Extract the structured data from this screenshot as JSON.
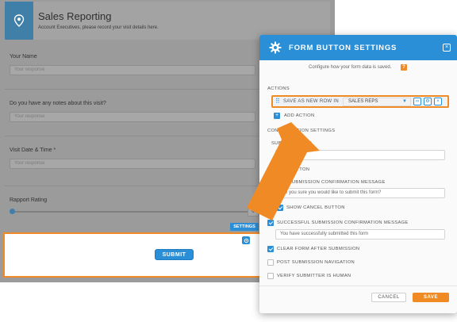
{
  "form": {
    "title": "Sales Reporting",
    "subtitle": "Account Executives, please record your visit details here.",
    "fields": [
      {
        "label": "Your Name",
        "placeholder": "Your response"
      },
      {
        "label": "Do you have any notes about this visit?",
        "placeholder": "Your response"
      },
      {
        "label": "Visit Date & Time *",
        "placeholder": "Your response"
      },
      {
        "label": "Rapport Rating",
        "slider_value": "0"
      }
    ],
    "settings_tab": "SETTINGS",
    "submit_label": "SUBMIT"
  },
  "modal": {
    "title": "FORM BUTTON SETTINGS",
    "subtitle": "Configure how your form data is saved.",
    "help": "?",
    "close": "×",
    "actions_label": "ACTIONS",
    "action_row": {
      "text": "SAVE AS NEW ROW IN",
      "selected": "SALES REPS",
      "caret": "▼"
    },
    "add_action": "ADD ACTION",
    "config_label": "CONFIGURATION SETTINGS",
    "submit_button_label": "SUBMIT BUTTON",
    "submit_button_value": "Submit",
    "clear_button_label": "CLEAR BUTTON",
    "pre_confirm_label": "PRE SUBMISSION CONFIRMATION MESSAGE",
    "pre_confirm_value": "Are you sure you would like to submit this form?",
    "show_cancel_label": "SHOW CANCEL BUTTON",
    "success_label": "SUCCESSFUL SUBMISSION CONFIRMATION MESSAGE",
    "success_value": "You have successfully submitted this form",
    "clear_after_label": "CLEAR FORM AFTER SUBMISSION",
    "post_nav_label": "POST SUBMISSION NAVIGATION",
    "verify_label": "VERIFY SUBMITTER IS HUMAN",
    "cancel_label": "CANCEL",
    "save_label": "SAVE"
  },
  "colors": {
    "accent_blue": "#2a8fd6",
    "accent_orange": "#f08a24"
  }
}
